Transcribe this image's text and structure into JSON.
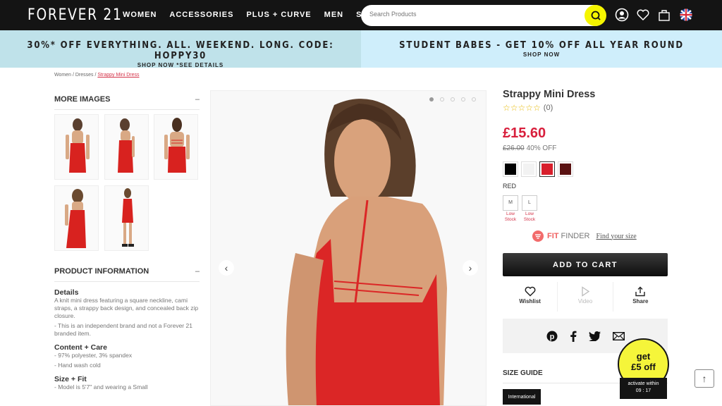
{
  "header": {
    "logo": "FOREVER 21",
    "nav": [
      "WOMEN",
      "ACCESSORIES",
      "PLUS + CURVE",
      "MEN",
      "SALE"
    ],
    "search_placeholder": "Search Products",
    "icons": [
      "account-icon",
      "wishlist-heart-icon",
      "shopping-bag-icon",
      "uk-flag-icon"
    ]
  },
  "promos": [
    {
      "main": "30%* OFF EVERYTHING. ALL. WEEKEND. LONG. CODE: HOPPY30",
      "sub": "SHOP NOW *SEE DETAILS"
    },
    {
      "main": "STUDENT BABES - GET 10% OFF ALL YEAR ROUND",
      "sub": "SHOP NOW"
    }
  ],
  "breadcrumb": {
    "items": [
      "Women",
      "Dresses"
    ],
    "separator": " / ",
    "current": "Strappy Mini Dress"
  },
  "left": {
    "more_images_title": "MORE IMAGES",
    "toggle": "–",
    "thumbnails": [
      "back-view",
      "side-view",
      "back-straps-view",
      "front-view",
      "full-length-view"
    ],
    "product_info_title": "PRODUCT INFORMATION",
    "details_title": "Details",
    "details_text": "A knit mini dress featuring a square neckline, cami straps, a strappy back design, and concealed back zip closure.",
    "details_note": "- This is an independent brand and not a Forever 21 branded item.",
    "care_title": "Content + Care",
    "care_items": [
      "- 97% polyester, 3% spandex",
      "- Hand wash cold"
    ],
    "fit_title": "Size + Fit",
    "fit_items": [
      "- Model is 5'7\" and wearing a Small"
    ]
  },
  "gallery": {
    "total_images": 5,
    "active_index": 1
  },
  "product": {
    "title": "Strappy Mini Dress",
    "stars": "☆☆☆☆☆",
    "rating_value": 0,
    "review_count": "(0)",
    "price": "£15.60",
    "original_price": "£26.00",
    "discount": "40% OFF",
    "swatches": [
      {
        "name": "black",
        "color": "#000000",
        "selected": false
      },
      {
        "name": "white",
        "color": "#f2f2f2",
        "selected": false
      },
      {
        "name": "red",
        "color": "#d81f2c",
        "selected": true
      },
      {
        "name": "burgundy",
        "color": "#5a1212",
        "selected": false
      }
    ],
    "selected_color": "RED",
    "sizes": [
      {
        "label": "M",
        "stock": "Low Stock"
      },
      {
        "label": "L",
        "stock": "Low Stock"
      }
    ],
    "fit_finder": {
      "brand_bold": "FIT",
      "brand_rest": " FINDER",
      "link": "Find your size"
    },
    "add_to_cart": "ADD TO CART",
    "actions": [
      {
        "label": "Wishlist",
        "icon": "heart-icon",
        "enabled": true
      },
      {
        "label": "Video",
        "icon": "play-icon",
        "enabled": false
      },
      {
        "label": "Share",
        "icon": "share-icon",
        "enabled": true
      }
    ],
    "social": [
      "pinterest-icon",
      "facebook-icon",
      "twitter-icon",
      "email-icon"
    ],
    "size_guide_title": "SIZE GUIDE",
    "size_guide_tab": "International"
  },
  "promo_badge": {
    "line1": "get",
    "line2": "£5 off",
    "timer_label": "activate within",
    "timer": "09 : 17"
  },
  "back_to_top": "↑",
  "colors": {
    "accent_red": "#d81f3c",
    "search_yellow": "#f5f500",
    "nav_bg": "#141414",
    "promo_left": "#bfe2ea",
    "promo_right": "#cfeefb"
  }
}
